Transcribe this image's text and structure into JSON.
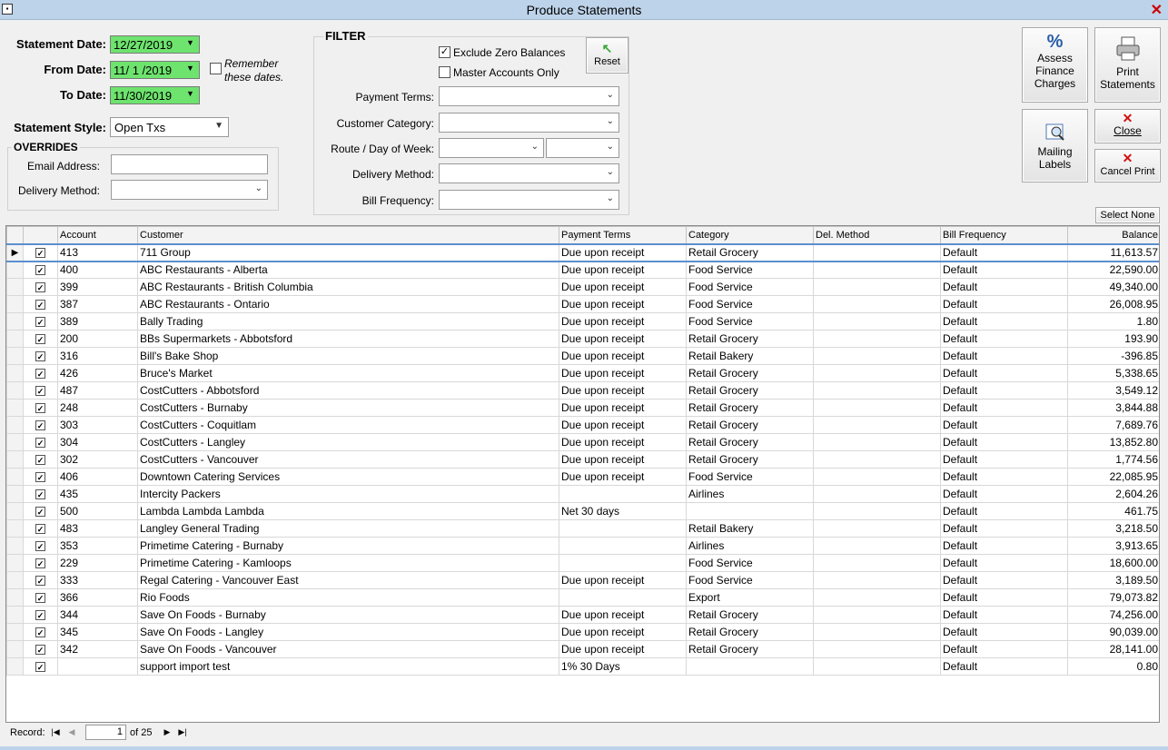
{
  "window": {
    "title": "Produce Statements"
  },
  "dates": {
    "statement_label": "Statement Date:",
    "statement_value": "12/27/2019",
    "from_label": "From Date:",
    "from_value": "11/ 1 /2019",
    "to_label": "To Date:",
    "to_value": "11/30/2019",
    "remember_label_1": "Remember",
    "remember_label_2": "these dates.",
    "remember_checked": false
  },
  "style": {
    "label": "Statement Style:",
    "value": "Open Txs"
  },
  "overrides": {
    "title": "OVERRIDES",
    "email_label": "Email Address:",
    "email_value": "",
    "delivery_label": "Delivery Method:",
    "delivery_value": ""
  },
  "filter": {
    "title": "FILTER",
    "exclude_zero_label": "Exclude Zero Balances",
    "exclude_zero_checked": true,
    "master_only_label": "Master Accounts Only",
    "master_only_checked": false,
    "reset_label": "Reset",
    "payment_terms_label": "Payment Terms:",
    "customer_category_label": "Customer Category:",
    "route_label": "Route / Day of Week:",
    "delivery_method_label": "Delivery Method:",
    "bill_frequency_label": "Bill Frequency:"
  },
  "buttons": {
    "assess_1": "Assess",
    "assess_2": "Finance",
    "assess_3": "Charges",
    "print_1": "Print",
    "print_2": "Statements",
    "mailing_1": "Mailing",
    "mailing_2": "Labels",
    "close": "Close",
    "cancel_print": "Cancel Print",
    "select_none": "Select None"
  },
  "grid": {
    "columns": [
      "Account",
      "Customer",
      "Payment Terms",
      "Category",
      "Del. Method",
      "Bill Frequency",
      "Balance"
    ],
    "rows": [
      {
        "account": "413",
        "customer": "711 Group",
        "terms": "Due upon receipt",
        "category": "Retail Grocery",
        "del": "",
        "freq": "Default",
        "balance": "11,613.57"
      },
      {
        "account": "400",
        "customer": "ABC Restaurants - Alberta",
        "terms": "Due upon receipt",
        "category": "Food Service",
        "del": "",
        "freq": "Default",
        "balance": "22,590.00"
      },
      {
        "account": "399",
        "customer": "ABC Restaurants - British Columbia",
        "terms": "Due upon receipt",
        "category": "Food Service",
        "del": "",
        "freq": "Default",
        "balance": "49,340.00"
      },
      {
        "account": "387",
        "customer": "ABC Restaurants - Ontario",
        "terms": "Due upon receipt",
        "category": "Food Service",
        "del": "",
        "freq": "Default",
        "balance": "26,008.95"
      },
      {
        "account": "389",
        "customer": "Bally Trading",
        "terms": "Due upon receipt",
        "category": "Food Service",
        "del": "",
        "freq": "Default",
        "balance": "1.80"
      },
      {
        "account": "200",
        "customer": "BBs Supermarkets - Abbotsford",
        "terms": "Due upon receipt",
        "category": "Retail Grocery",
        "del": "",
        "freq": "Default",
        "balance": "193.90"
      },
      {
        "account": "316",
        "customer": "Bill's Bake Shop",
        "terms": "Due upon receipt",
        "category": "Retail Bakery",
        "del": "",
        "freq": "Default",
        "balance": "-396.85"
      },
      {
        "account": "426",
        "customer": "Bruce's Market",
        "terms": "Due upon receipt",
        "category": "Retail Grocery",
        "del": "",
        "freq": "Default",
        "balance": "5,338.65"
      },
      {
        "account": "487",
        "customer": "CostCutters - Abbotsford",
        "terms": "Due upon receipt",
        "category": "Retail Grocery",
        "del": "",
        "freq": "Default",
        "balance": "3,549.12"
      },
      {
        "account": "248",
        "customer": "CostCutters - Burnaby",
        "terms": "Due upon receipt",
        "category": "Retail Grocery",
        "del": "",
        "freq": "Default",
        "balance": "3,844.88"
      },
      {
        "account": "303",
        "customer": "CostCutters - Coquitlam",
        "terms": "Due upon receipt",
        "category": "Retail Grocery",
        "del": "",
        "freq": "Default",
        "balance": "7,689.76"
      },
      {
        "account": "304",
        "customer": "CostCutters - Langley",
        "terms": "Due upon receipt",
        "category": "Retail Grocery",
        "del": "",
        "freq": "Default",
        "balance": "13,852.80"
      },
      {
        "account": "302",
        "customer": "CostCutters - Vancouver",
        "terms": "Due upon receipt",
        "category": "Retail Grocery",
        "del": "",
        "freq": "Default",
        "balance": "1,774.56"
      },
      {
        "account": "406",
        "customer": "Downtown Catering Services",
        "terms": "Due upon receipt",
        "category": "Food Service",
        "del": "",
        "freq": "Default",
        "balance": "22,085.95"
      },
      {
        "account": "435",
        "customer": "Intercity Packers",
        "terms": "",
        "category": "Airlines",
        "del": "",
        "freq": "Default",
        "balance": "2,604.26"
      },
      {
        "account": "500",
        "customer": "Lambda Lambda Lambda",
        "terms": "Net 30 days",
        "category": "",
        "del": "",
        "freq": "Default",
        "balance": "461.75"
      },
      {
        "account": "483",
        "customer": "Langley General Trading",
        "terms": "",
        "category": "Retail Bakery",
        "del": "",
        "freq": "Default",
        "balance": "3,218.50"
      },
      {
        "account": "353",
        "customer": "Primetime Catering - Burnaby",
        "terms": "",
        "category": "Airlines",
        "del": "",
        "freq": "Default",
        "balance": "3,913.65"
      },
      {
        "account": "229",
        "customer": "Primetime Catering - Kamloops",
        "terms": "",
        "category": "Food Service",
        "del": "",
        "freq": "Default",
        "balance": "18,600.00"
      },
      {
        "account": "333",
        "customer": "Regal Catering - Vancouver East",
        "terms": "Due upon receipt",
        "category": "Food Service",
        "del": "",
        "freq": "Default",
        "balance": "3,189.50"
      },
      {
        "account": "366",
        "customer": "Rio Foods",
        "terms": "",
        "category": "Export",
        "del": "",
        "freq": "Default",
        "balance": "79,073.82"
      },
      {
        "account": "344",
        "customer": "Save On Foods - Burnaby",
        "terms": "Due upon receipt",
        "category": "Retail Grocery",
        "del": "",
        "freq": "Default",
        "balance": "74,256.00"
      },
      {
        "account": "345",
        "customer": "Save On Foods - Langley",
        "terms": "Due upon receipt",
        "category": "Retail Grocery",
        "del": "",
        "freq": "Default",
        "balance": "90,039.00"
      },
      {
        "account": "342",
        "customer": "Save On Foods - Vancouver",
        "terms": "Due upon receipt",
        "category": "Retail Grocery",
        "del": "",
        "freq": "Default",
        "balance": "28,141.00"
      },
      {
        "account": "",
        "customer": "support import test",
        "terms": "1% 30 Days",
        "category": "",
        "del": "",
        "freq": "Default",
        "balance": "0.80"
      }
    ]
  },
  "navigator": {
    "label": "Record:",
    "current": "1",
    "total": "of 25"
  }
}
